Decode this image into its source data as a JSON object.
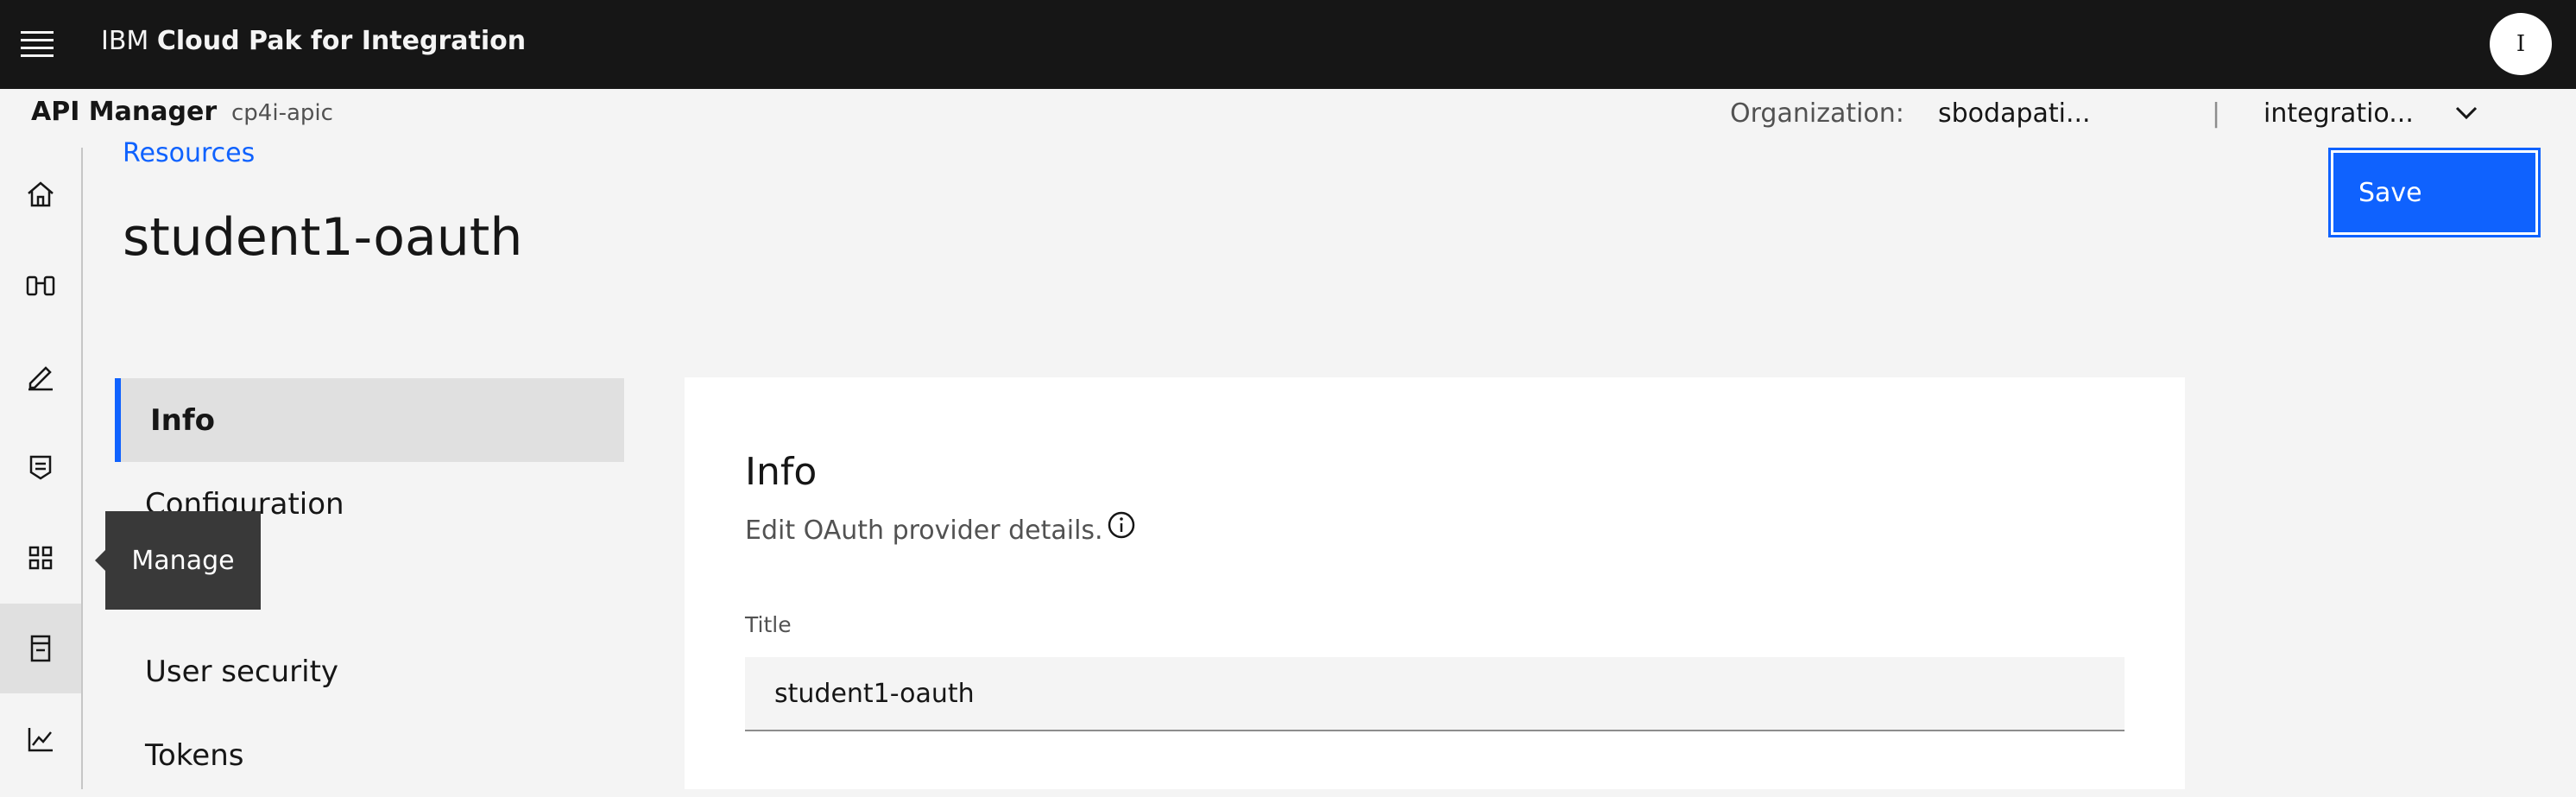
{
  "header": {
    "brand_prefix": "IBM",
    "brand_product": "Cloud Pak for Integration",
    "avatar_initial": "I"
  },
  "subheader": {
    "app_name": "API Manager",
    "catalog": "cp4i-apic",
    "org_label": "Organization:",
    "org_value": "sbodapati...",
    "separator": "|",
    "space_value": "integratio..."
  },
  "sidenav": {
    "items": [
      {
        "name": "home",
        "icon": "home-icon"
      },
      {
        "name": "explore",
        "icon": "binoculars-icon"
      },
      {
        "name": "develop",
        "icon": "pencil-icon"
      },
      {
        "name": "test",
        "icon": "checklist-icon"
      },
      {
        "name": "manage",
        "icon": "grid-icon"
      },
      {
        "name": "resources",
        "icon": "building-icon"
      },
      {
        "name": "analytics",
        "icon": "chart-line-icon"
      }
    ],
    "tooltip": "Manage"
  },
  "page": {
    "breadcrumb": "Resources",
    "title": "student1-oauth",
    "save_label": "Save"
  },
  "tabs": [
    "Info",
    "Configuration",
    "",
    "User security",
    "Tokens"
  ],
  "info_card": {
    "title": "Info",
    "description": "Edit OAuth provider details.",
    "title_field_label": "Title",
    "title_field_value": "student1-oauth"
  },
  "colors": {
    "accent": "#0f62fe",
    "topbar": "#161616",
    "tooltip": "#393939"
  }
}
